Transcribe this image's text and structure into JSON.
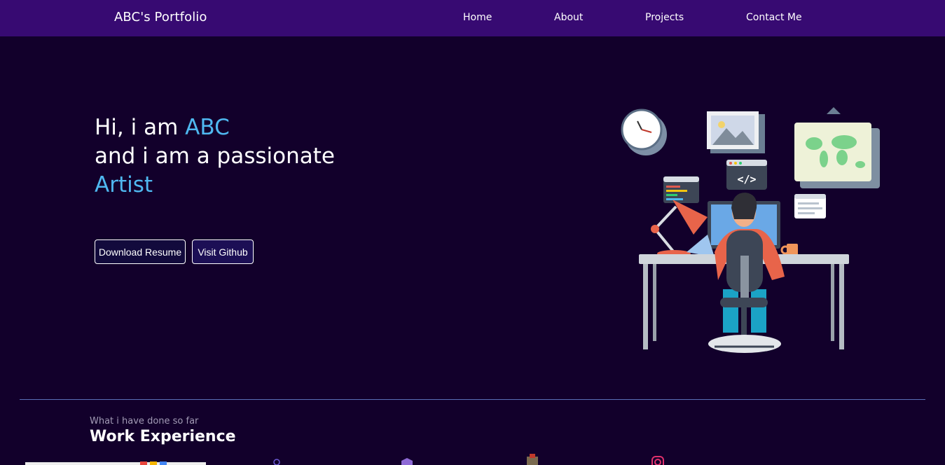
{
  "nav": {
    "brand": "ABC's Portfolio",
    "links": [
      "Home",
      "About",
      "Projects",
      "Contact Me"
    ]
  },
  "hero": {
    "line1_prefix": "Hi, i am ",
    "name": "ABC",
    "line2": "and i am a passionate",
    "role": "Artist",
    "buttons": {
      "resume": "Download Resume",
      "github": "Visit Github"
    },
    "illustration": "developer-at-desk-illustration"
  },
  "experience": {
    "subtitle": "What i have done so far",
    "title": "Work Experience"
  },
  "colors": {
    "nav_bg": "#370a72",
    "page_bg": "#12002b",
    "accent": "#4fb8f0"
  }
}
